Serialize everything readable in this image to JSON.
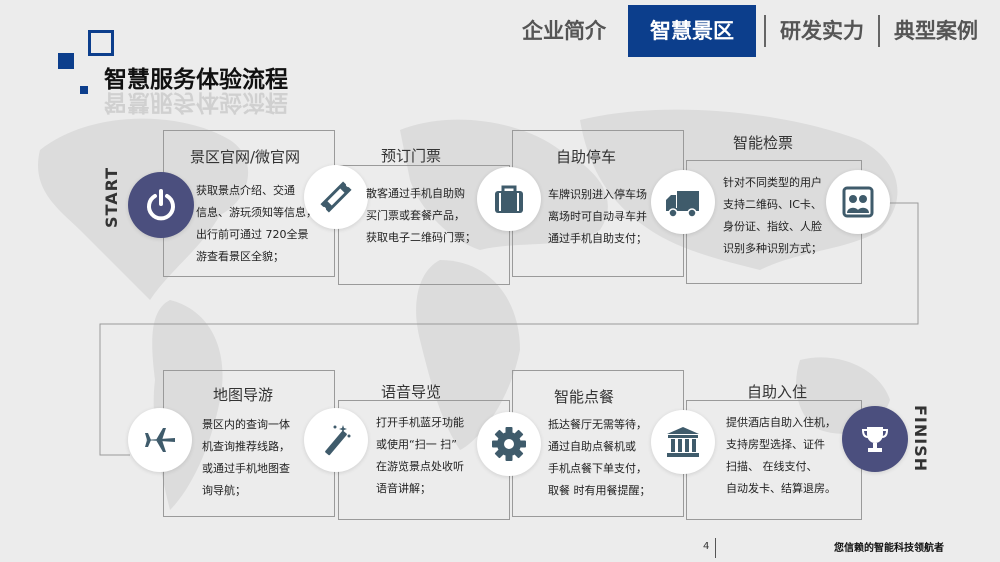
{
  "nav": {
    "tabs": [
      {
        "label": "企业简介"
      },
      {
        "label": "智慧景区"
      },
      {
        "label": "研发实力"
      },
      {
        "label": "典型案例"
      }
    ],
    "active_index": 1
  },
  "title": "智慧服务体验流程",
  "start_label": "START",
  "finish_label": "FINISH",
  "steps": [
    {
      "label": "景区官网/微官网",
      "icon": "power-icon",
      "lines": [
        "获取景点介绍、交通",
        "信息、游玩须知等信息，",
        "出行前可通过 720全景",
        "游查看景区全貌；"
      ]
    },
    {
      "label": "预订门票",
      "icon": "ticket-icon",
      "lines": [
        "散客通过手机自助购",
        "买门票或套餐产品，",
        "获取电子二维码门票；"
      ]
    },
    {
      "label": "自助停车",
      "icon": "briefcase-icon",
      "lines": [
        "车牌识别进入停车场",
        "离场时可自动寻车并",
        "通过手机自助支付；"
      ]
    },
    {
      "label": "智能检票",
      "icon": "truck-icon",
      "lines": [
        "针对不同类型的用户",
        "支持二维码、IC卡、",
        "身份证、指纹、人脸",
        "识别多种识别方式；"
      ]
    },
    {
      "label": "地图导游",
      "icon": "airplane-icon",
      "lines": [
        "景区内的查询一体",
        "机查询推荐线路，",
        "或通过手机地图查",
        "询导航；"
      ]
    },
    {
      "label": "语音导览",
      "icon": "magic-wand-icon",
      "lines": [
        "打开手机蓝牙功能",
        "或使用“扫一 扫”",
        "在游览景点处收听",
        "语音讲解；"
      ]
    },
    {
      "label": "智能点餐",
      "icon": "gear-icon",
      "lines": [
        "抵达餐厅无需等待，",
        "通过自助点餐机或",
        "手机点餐下单支付，",
        "取餐 时有用餐提醒；"
      ]
    },
    {
      "label": "自助入住",
      "icon": "bank-icon",
      "lines": [
        "提供酒店自助入住机，",
        "支持房型选择、证件",
        "扫描、 在线支付、",
        "自动发卡、结算退房。"
      ]
    }
  ],
  "footer": {
    "page_number": "4",
    "slogan": "您信赖的智能科技领航者"
  },
  "colors": {
    "accent": "#0c3e8c",
    "icon": "#3f5b6b",
    "circle_dark": "#4b4f7e"
  }
}
